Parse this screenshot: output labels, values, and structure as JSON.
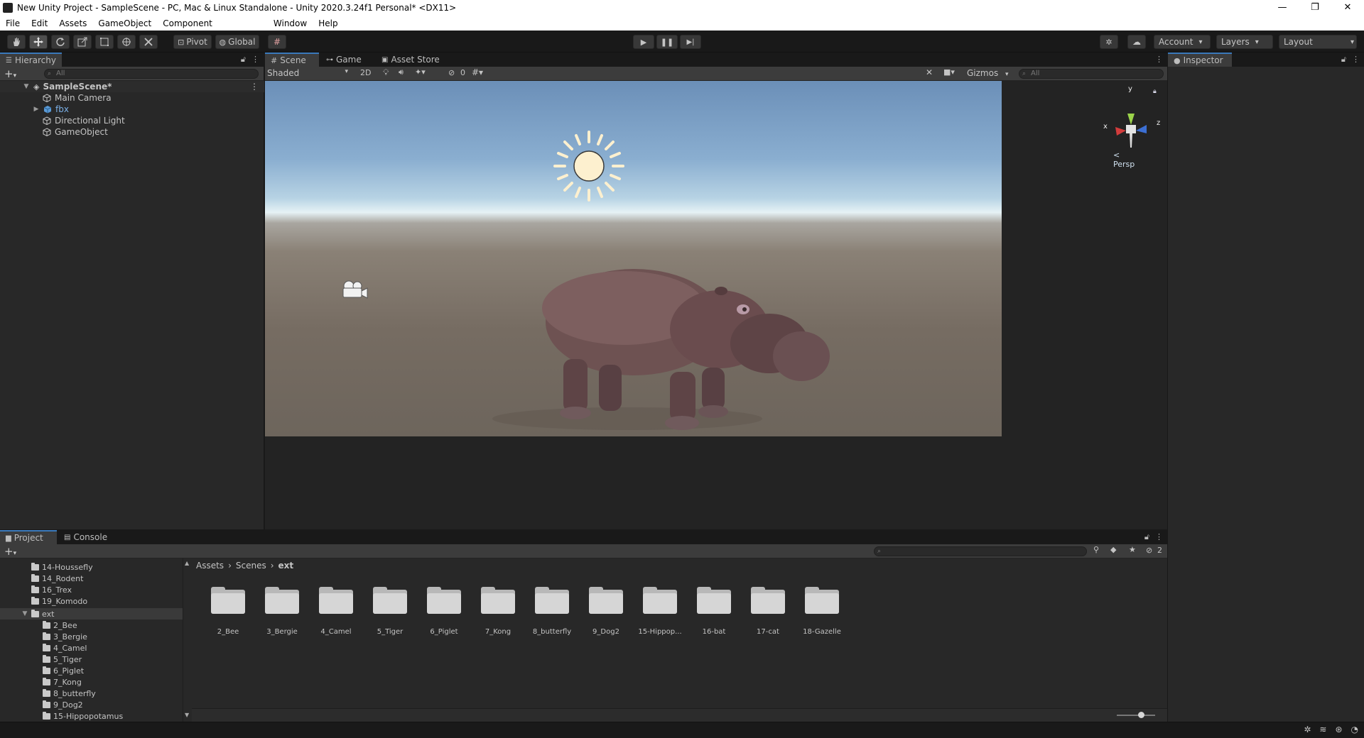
{
  "window": {
    "title": "New Unity Project - SampleScene - PC, Mac & Linux Standalone - Unity 2020.3.24f1 Personal* <DX11>",
    "controls": [
      "—",
      "❐",
      "✕"
    ]
  },
  "menu": [
    "File",
    "Edit",
    "Assets",
    "GameObject",
    "Component",
    "Window",
    "Help"
  ],
  "toolbar": {
    "pivot_label": "Pivot",
    "global_label": "Global",
    "account_label": "Account",
    "layers_label": "Layers",
    "layout_label": "Layout"
  },
  "hierarchy": {
    "tab_label": "Hierarchy",
    "search_placeholder": "All",
    "scene_name": "SampleScene*",
    "items": [
      {
        "label": "Main Camera",
        "expandable": false,
        "prefab": false
      },
      {
        "label": "fbx",
        "expandable": true,
        "prefab": true
      },
      {
        "label": "Directional Light",
        "expandable": false,
        "prefab": false
      },
      {
        "label": "GameObject",
        "expandable": false,
        "prefab": false
      }
    ]
  },
  "scene": {
    "tabs": [
      "Scene",
      "Game",
      "Asset Store"
    ],
    "shading_mode": "Shaded",
    "mode_2d": "2D",
    "hidden_count": "0",
    "gizmos_label": "Gizmos",
    "search_placeholder": "All",
    "projection_label": "< Persp",
    "axis_labels": {
      "x": "x",
      "y": "y",
      "z": "z"
    }
  },
  "inspector": {
    "tab_label": "Inspector"
  },
  "project": {
    "tabs": [
      "Project",
      "Console"
    ],
    "hidden_count": "2",
    "breadcrumb": [
      "Assets",
      "Scenes",
      "ext"
    ],
    "tree": [
      {
        "label": "14-Houssefly",
        "depth": 0
      },
      {
        "label": "14_Rodent",
        "depth": 0
      },
      {
        "label": "16_Trex",
        "depth": 0
      },
      {
        "label": "19_Komodo",
        "depth": 0
      },
      {
        "label": "ext",
        "depth": 0,
        "expanded": true,
        "selected": true
      },
      {
        "label": "2_Bee",
        "depth": 1
      },
      {
        "label": "3_Bergie",
        "depth": 1
      },
      {
        "label": "4_Camel",
        "depth": 1
      },
      {
        "label": "5_Tiger",
        "depth": 1
      },
      {
        "label": "6_Piglet",
        "depth": 1
      },
      {
        "label": "7_Kong",
        "depth": 1
      },
      {
        "label": "8_butterfly",
        "depth": 1
      },
      {
        "label": "9_Dog2",
        "depth": 1
      },
      {
        "label": "15-Hippopotamus",
        "depth": 1
      }
    ],
    "folders": [
      "2_Bee",
      "3_Bergie",
      "4_Camel",
      "5_Tiger",
      "6_Piglet",
      "7_Kong",
      "8_butterfly",
      "9_Dog2",
      "15-Hippop...",
      "16-bat",
      "17-cat",
      "18-Gazelle"
    ]
  },
  "colors": {
    "accent": "#3a79bb",
    "panel": "#282828",
    "header": "#3c3c3c",
    "sky_top": "#6b8fb8",
    "ground": "#766c62"
  }
}
